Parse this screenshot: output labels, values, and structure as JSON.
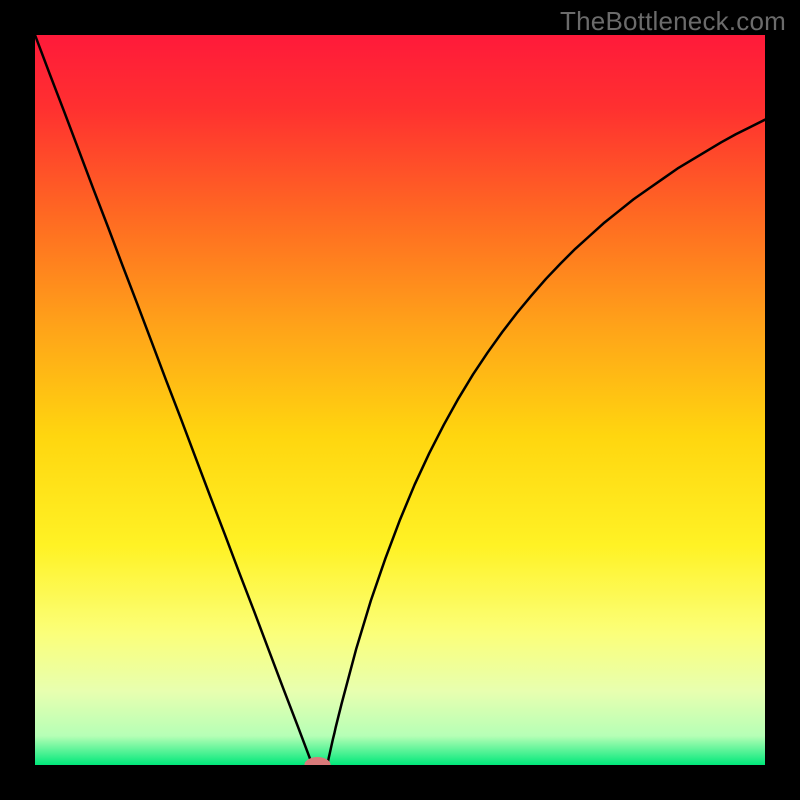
{
  "watermark": "TheBottleneck.com",
  "chart_data": {
    "type": "line",
    "title": "",
    "xlabel": "",
    "ylabel": "",
    "xlim": [
      0,
      1
    ],
    "ylim": [
      0,
      1
    ],
    "gradient_stops": [
      {
        "offset": 0.0,
        "color": "#ff1a3a"
      },
      {
        "offset": 0.1,
        "color": "#ff3030"
      },
      {
        "offset": 0.25,
        "color": "#ff6a22"
      },
      {
        "offset": 0.4,
        "color": "#ffa319"
      },
      {
        "offset": 0.55,
        "color": "#ffd60f"
      },
      {
        "offset": 0.7,
        "color": "#fff225"
      },
      {
        "offset": 0.82,
        "color": "#fbff7a"
      },
      {
        "offset": 0.9,
        "color": "#e7ffb0"
      },
      {
        "offset": 0.96,
        "color": "#b6ffb6"
      },
      {
        "offset": 1.0,
        "color": "#00e87a"
      }
    ],
    "series": [
      {
        "name": "curve",
        "color": "#000000",
        "x": [
          0.0,
          0.02,
          0.04,
          0.06,
          0.08,
          0.1,
          0.12,
          0.14,
          0.16,
          0.18,
          0.2,
          0.22,
          0.24,
          0.26,
          0.28,
          0.3,
          0.32,
          0.34,
          0.36,
          0.38,
          0.382,
          0.384,
          0.386,
          0.388,
          0.39,
          0.392,
          0.394,
          0.396,
          0.398,
          0.4,
          0.402,
          0.404,
          0.406,
          0.408,
          0.41,
          0.412,
          0.414,
          0.416,
          0.418,
          0.42,
          0.44,
          0.46,
          0.48,
          0.5,
          0.52,
          0.54,
          0.56,
          0.58,
          0.6,
          0.62,
          0.64,
          0.66,
          0.68,
          0.7,
          0.72,
          0.74,
          0.76,
          0.78,
          0.8,
          0.82,
          0.84,
          0.86,
          0.88,
          0.9,
          0.92,
          0.94,
          0.96,
          0.98,
          1.0
        ],
        "y": [
          1.0,
          0.947,
          0.895,
          0.842,
          0.789,
          0.737,
          0.684,
          0.632,
          0.579,
          0.526,
          0.474,
          0.421,
          0.368,
          0.316,
          0.263,
          0.211,
          0.158,
          0.105,
          0.053,
          0.0,
          0.0,
          0.0,
          0.0,
          0.0,
          0.0,
          0.0,
          0.0,
          0.0,
          0.0,
          0.0,
          0.008,
          0.017,
          0.026,
          0.035,
          0.043,
          0.052,
          0.06,
          0.068,
          0.076,
          0.084,
          0.159,
          0.225,
          0.283,
          0.336,
          0.384,
          0.427,
          0.466,
          0.502,
          0.535,
          0.565,
          0.593,
          0.619,
          0.643,
          0.666,
          0.687,
          0.707,
          0.725,
          0.743,
          0.759,
          0.775,
          0.789,
          0.803,
          0.817,
          0.829,
          0.841,
          0.853,
          0.864,
          0.874,
          0.884
        ]
      }
    ],
    "marker": {
      "name": "min-marker",
      "x": 0.387,
      "y": 0.0,
      "rx": 0.018,
      "ry": 0.011,
      "color": "#d97a7a"
    }
  }
}
